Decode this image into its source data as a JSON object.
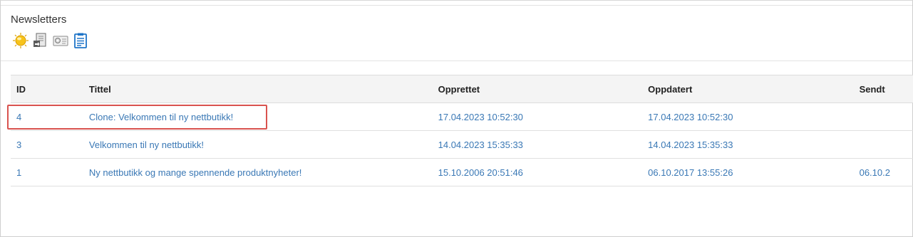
{
  "panel": {
    "title": "Newsletters"
  },
  "toolbar": {
    "icons": [
      "new-newsletter-icon",
      "import-icon",
      "settings-icon",
      "list-icon"
    ]
  },
  "table": {
    "headers": [
      "ID",
      "Tittel",
      "Opprettet",
      "Oppdatert",
      "Sendt"
    ],
    "rows": [
      {
        "id": "4",
        "title": "Clone: Velkommen til ny nettbutikk!",
        "created": "17.04.2023 10:52:30",
        "updated": "17.04.2023 10:52:30",
        "sent": ""
      },
      {
        "id": "3",
        "title": "Velkommen til ny nettbutikk!",
        "created": "14.04.2023 15:35:33",
        "updated": "14.04.2023 15:35:33",
        "sent": ""
      },
      {
        "id": "1",
        "title": "Ny nettbutikk og mange spennende produktnyheter!",
        "created": "15.10.2006 20:51:46",
        "updated": "06.10.2017 13:55:26",
        "sent": "06.10.2"
      }
    ]
  },
  "colors": {
    "link": "#3a78b5",
    "highlight": "#d9534f"
  }
}
